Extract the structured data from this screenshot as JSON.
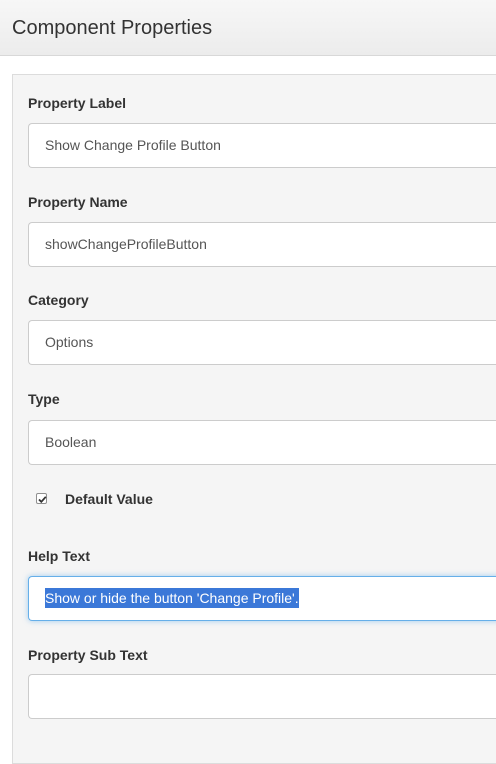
{
  "header": {
    "title": "Component Properties"
  },
  "form": {
    "property_label": {
      "label": "Property Label",
      "value": "Show Change Profile Button"
    },
    "property_name": {
      "label": "Property Name",
      "value": "showChangeProfileButton"
    },
    "category": {
      "label": "Category",
      "value": "Options"
    },
    "type": {
      "label": "Type",
      "value": "Boolean"
    },
    "default_value": {
      "label": "Default Value",
      "checked": true
    },
    "help_text": {
      "label": "Help Text",
      "value": "Show or hide the button 'Change Profile'.",
      "selected": true
    },
    "property_sub_text": {
      "label": "Property Sub Text",
      "value": ""
    }
  },
  "colors": {
    "selection": "#3b78d8",
    "focus_border": "#66afe9",
    "panel_background": "#f5f5f5"
  }
}
